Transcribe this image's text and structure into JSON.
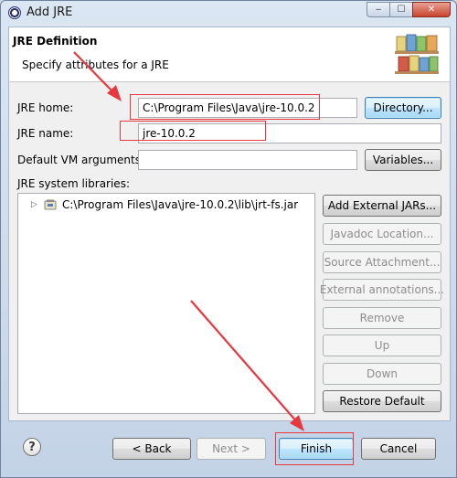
{
  "window": {
    "title": "Add JRE",
    "controls": {
      "minimize": "‒",
      "maximize": "☐",
      "close": "✕"
    }
  },
  "header": {
    "title": "JRE Definition",
    "message": "Specify attributes for a JRE",
    "image_icon": "bookshelf-icon"
  },
  "form": {
    "jre_home": {
      "label": "JRE home:",
      "value": "C:\\Program Files\\Java\\jre-10.0.2"
    },
    "jre_name": {
      "label": "JRE name:",
      "value": "jre-10.0.2"
    },
    "vm_args": {
      "label": "Default VM arguments:",
      "value": ""
    },
    "directory_button": "Directory...",
    "variables_button": "Variables...",
    "libraries_label": "JRE system libraries:",
    "libraries": [
      {
        "path": "C:\\Program Files\\Java\\jre-10.0.2\\lib\\jrt-fs.jar",
        "icon": "jar-file-icon"
      }
    ]
  },
  "library_buttons": {
    "add_external_jars": "Add External JARs...",
    "javadoc_location": "Javadoc Location...",
    "source_attachment": "Source Attachment...",
    "external_annotations": "External annotations...",
    "remove": "Remove",
    "up": "Up",
    "down": "Down",
    "restore_default": "Restore Default"
  },
  "footer": {
    "help": "?",
    "back": "< Back",
    "next": "Next >",
    "finish": "Finish",
    "cancel": "Cancel"
  },
  "annotation_color": "#e8383f"
}
